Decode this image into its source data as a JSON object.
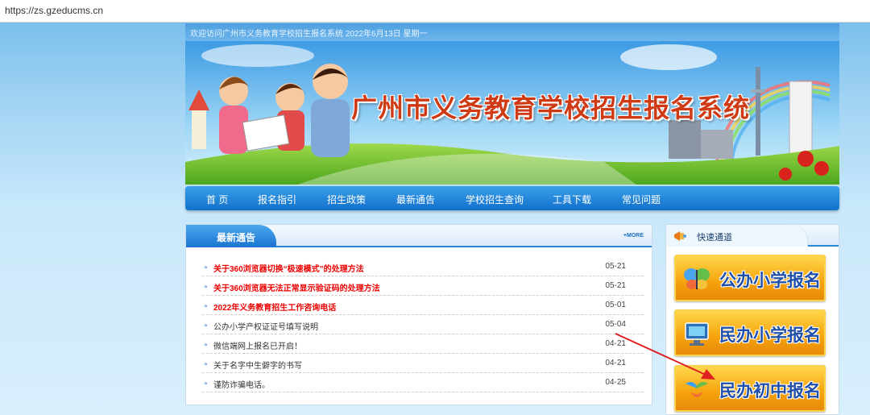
{
  "address_bar": {
    "url": "https://zs.gzeducms.cn"
  },
  "welcome": {
    "text": "欢迎访问广州市义务教育学校招生报名系统 2022年6月13日 星期一"
  },
  "banner": {
    "title": "广州市义务教育学校招生报名系统"
  },
  "nav": {
    "items": [
      "首 页",
      "报名指引",
      "招生政策",
      "最新通告",
      "学校招生查询",
      "工具下载",
      "常见问题"
    ]
  },
  "news": {
    "title": "最新通告",
    "more_label": "+MORE",
    "items": [
      {
        "text": "关于360浏览器切换“极速模式”的处理方法",
        "date": "05-21",
        "highlight": true
      },
      {
        "text": "关于360浏览器无法正常显示验证码的处理方法",
        "date": "05-21",
        "highlight": true
      },
      {
        "text": "2022年义务教育招生工作咨询电话",
        "date": "05-01",
        "highlight": true
      },
      {
        "text": "公办小学产权证证号填写说明",
        "date": "05-04",
        "highlight": false
      },
      {
        "text": "微信端网上报名已开启！",
        "date": "04-21",
        "highlight": false
      },
      {
        "text": "关于名字中生僻字的书写",
        "date": "04-21",
        "highlight": false
      },
      {
        "text": "谨防诈骗电话。",
        "date": "04-25",
        "highlight": false
      }
    ]
  },
  "quick": {
    "title": "快速通道",
    "buttons": [
      {
        "label": "公办小学报名",
        "icon": "butterfly-icon"
      },
      {
        "label": "民办小学报名",
        "icon": "monitor-icon"
      },
      {
        "label": "民办初中报名",
        "icon": "bird-icon"
      }
    ]
  },
  "colors": {
    "nav_blue": "#1a74cf",
    "highlight_red": "#e00000",
    "button_orange": "#f5a30c",
    "title_red": "#cf3a14"
  }
}
